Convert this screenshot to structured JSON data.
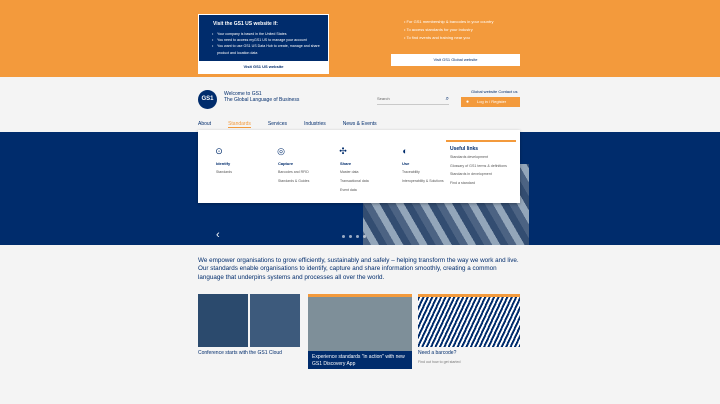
{
  "banner": {
    "card_title": "Visit the GS1 US website if:",
    "items": [
      "Your company is based in the United States",
      "You need to access myGS1 US to manage your account",
      "You want to use GS1 US Data Hub to create, manage and share product and location data"
    ],
    "button": "Visit GS1 US website",
    "right_items": [
      "• For GS1 membership & barcodes in your country",
      "• To access standards for your industry",
      "• To find events and training near you"
    ],
    "right_button": "Visit GS1 Global website"
  },
  "header": {
    "logo": "GS1",
    "tagline1": "Welcome to GS1",
    "tagline2": "The Global Language of Business",
    "search_placeholder": "Search",
    "util": "Global website   Contact us",
    "login": "Log in / Register"
  },
  "nav": [
    "About",
    "Standards",
    "Services",
    "Industries",
    "News & Events"
  ],
  "mega": {
    "columns": [
      {
        "title": "Identify",
        "items": [
          "Identify",
          "Standards"
        ]
      },
      {
        "title": "Capture",
        "items": [
          "Barcodes and RFID",
          "Standards & Guides"
        ]
      },
      {
        "title": "Share",
        "items": [
          "Master data",
          "Transactional data",
          "Event data"
        ]
      },
      {
        "title": "Use",
        "items": [
          "Traceability",
          "Interoperability & Solutions"
        ]
      }
    ],
    "useful_title": "Useful links",
    "useful_links": [
      "Standards development",
      "Glossary of GS1 terms & definitions",
      "Standards in development",
      "Find a standard"
    ]
  },
  "intro": "We empower organisations to grow efficiently, sustainably and safely – helping transform the way we work and live. Our standards enable organisations to identify, capture and share information smoothly, creating a common language that underpins systems and processes all over the world.",
  "cards": [
    {
      "caption": "Conference starts with the GS1 Cloud"
    },
    {
      "caption": "Experience standards \"in action\" with new GS1 Discovery App"
    },
    {
      "caption": "Need a barcode?",
      "sub": "Find out how to get started"
    }
  ]
}
